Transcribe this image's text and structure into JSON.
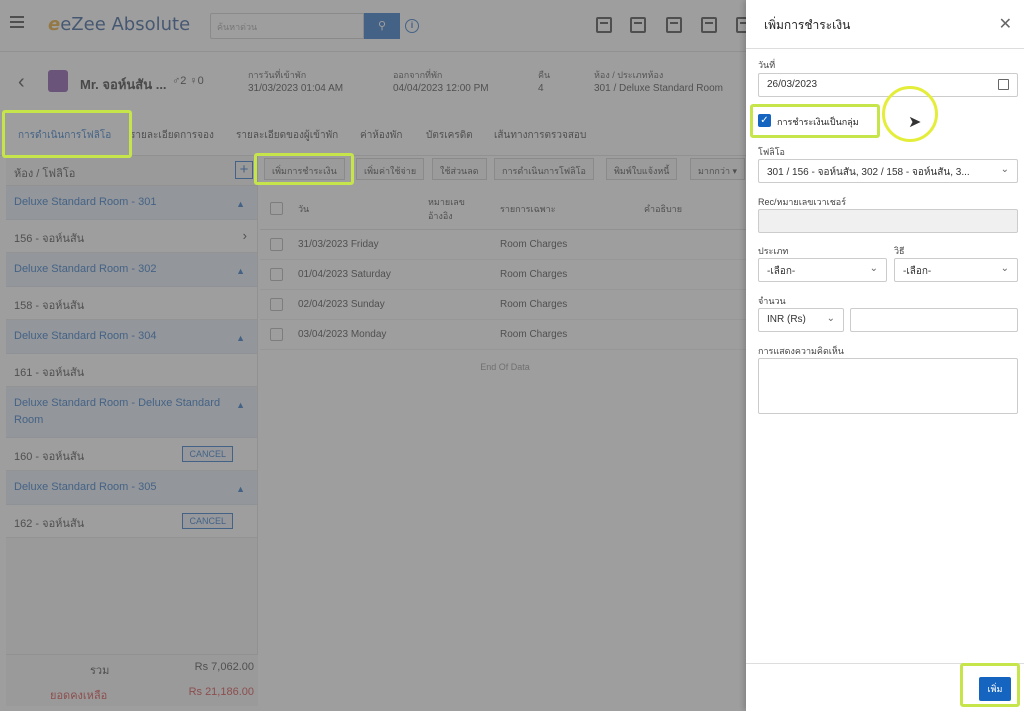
{
  "app": {
    "title": "eZee Absolute",
    "search_placeholder": "ค้นหาด่วน"
  },
  "guest": {
    "name": "Mr. จอห์นสัน ...",
    "counts": "♂2 ♀0",
    "checkin_label": "การวันที่เข้าพัก",
    "checkin_value": "31/03/2023 01:04 AM",
    "checkout_label": "ออกจากที่พัก",
    "checkout_value": "04/04/2023 12:00 PM",
    "nights_label": "คืน",
    "nights_value": "4",
    "room_label": "ห้อง / ประเภทห้อง",
    "room_value": "301 / Deluxe Standard Room"
  },
  "tabs": [
    "การดำเนินการโฟลิโอ",
    "รายละเอียดการจอง",
    "รายละเอียดของผู้เข้าพัก",
    "ค่าห้องพัก",
    "บัตรเครดิต",
    "เส้นทางการตรวจสอบ"
  ],
  "left_panel": {
    "header": "ห้อง / โฟลิโอ",
    "rooms": [
      {
        "title": "Deluxe Standard Room - 301",
        "folio": "156 - จอห์นสัน",
        "cancel": ""
      },
      {
        "title": "Deluxe Standard Room - 302",
        "folio": "158 - จอห์นสัน",
        "cancel": ""
      },
      {
        "title": "Deluxe Standard Room - 304",
        "folio": "161 - จอห์นสัน",
        "cancel": ""
      },
      {
        "title": "Deluxe Standard Room - Deluxe Standard Room",
        "folio": "160 - จอห์นสัน",
        "cancel": "CANCEL"
      },
      {
        "title": "Deluxe Standard Room - 305",
        "folio": "162 - จอห์นสัน",
        "cancel": "CANCEL"
      }
    ],
    "total_label": "รวม",
    "total_value": "Rs 7,062.00",
    "balance_label": "ยอดคงเหลือ",
    "balance_value": "Rs 21,186.00"
  },
  "toolbar": [
    "เพิ่มการชำระเงิน",
    "เพิ่มค่าใช้จ่าย",
    "ใช้ส่วนลด",
    "การดำเนินการโฟลิโอ",
    "พิมพ์ใบแจ้งหนี้",
    "มากกว่า"
  ],
  "table": {
    "headers": {
      "date": "วัน",
      "ref_1": "หมายเลข",
      "ref_2": "อ้างอิง",
      "particulars": "รายการเฉพาะ",
      "description": "คำอธิบาย"
    },
    "rows": [
      {
        "date": "31/03/2023 Friday",
        "particulars": "Room Charges"
      },
      {
        "date": "01/04/2023 Saturday",
        "particulars": "Room Charges"
      },
      {
        "date": "02/04/2023 Sunday",
        "particulars": "Room Charges"
      },
      {
        "date": "03/04/2023 Monday",
        "particulars": "Room Charges"
      }
    ],
    "end_text": "End Of Data"
  },
  "drawer": {
    "title": "เพิ่มการชำระเงิน",
    "date_label": "วันที่",
    "date_value": "26/03/2023",
    "group_payment_label": "การชำระเงินเป็นกลุ่ม",
    "group_payment_checked": true,
    "folio_label": "โฟลิโอ",
    "folio_value": "301 / 156 - จอห์นสัน, 302 / 158 - จอห์นสัน, 3...",
    "rec_label": "Rec/หมายเลขเวาเชอร์",
    "type_label": "ประเภท",
    "type_value": "-เลือก-",
    "method_label": "วิธี",
    "method_value": "-เลือก-",
    "amount_label": "จำนวน",
    "currency_value": "INR (Rs)",
    "comment_label": "การแสดงความคิดเห็น",
    "add_button": "เพิ่ม"
  },
  "colors": {
    "accent": "#1565c0",
    "highlight": "#c6e54a",
    "danger": "#d32f2f"
  }
}
